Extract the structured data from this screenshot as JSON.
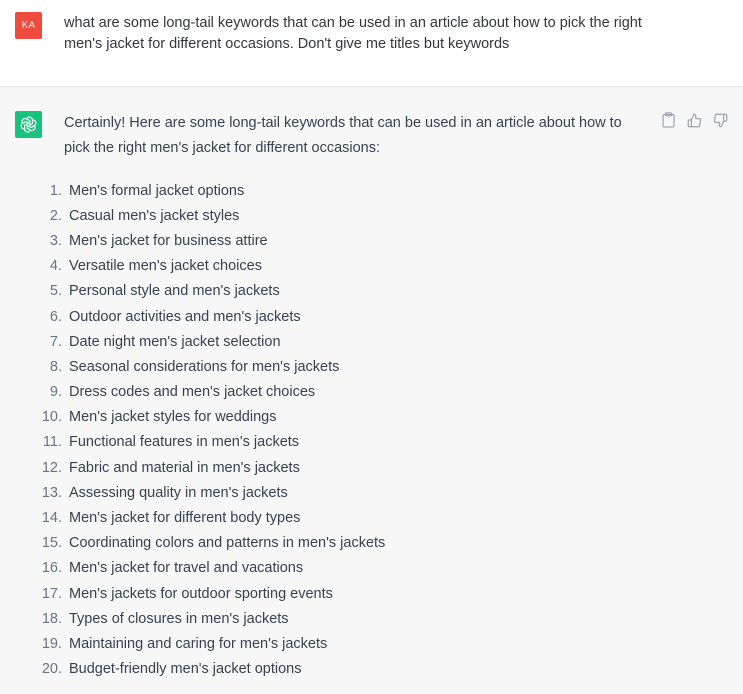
{
  "user_message": {
    "avatar_initials": "KA",
    "avatar_color": "#ef4b3f",
    "text": "what are some long-tail keywords that can be used in an article about how to pick the right men's jacket for different occasions. Don't give me titles but keywords"
  },
  "assistant_message": {
    "avatar_icon": "openai-logo-icon",
    "avatar_color": "#19c37d",
    "intro": "Certainly! Here are some long-tail keywords that can be used in an article about how to pick the right men's jacket for different occasions:",
    "actions": [
      {
        "name": "copy",
        "icon": "clipboard-icon"
      },
      {
        "name": "thumbs-up",
        "icon": "thumbs-up-icon"
      },
      {
        "name": "thumbs-down",
        "icon": "thumbs-down-icon"
      }
    ],
    "keywords": [
      {
        "num": "1.",
        "text": "Men's formal jacket options"
      },
      {
        "num": "2.",
        "text": "Casual men's jacket styles"
      },
      {
        "num": "3.",
        "text": "Men's jacket for business attire"
      },
      {
        "num": "4.",
        "text": "Versatile men's jacket choices"
      },
      {
        "num": "5.",
        "text": "Personal style and men's jackets"
      },
      {
        "num": "6.",
        "text": "Outdoor activities and men's jackets"
      },
      {
        "num": "7.",
        "text": "Date night men's jacket selection"
      },
      {
        "num": "8.",
        "text": "Seasonal considerations for men's jackets"
      },
      {
        "num": "9.",
        "text": "Dress codes and men's jacket choices"
      },
      {
        "num": "10.",
        "text": "Men's jacket styles for weddings"
      },
      {
        "num": "11.",
        "text": "Functional features in men's jackets"
      },
      {
        "num": "12.",
        "text": "Fabric and material in men's jackets"
      },
      {
        "num": "13.",
        "text": "Assessing quality in men's jackets"
      },
      {
        "num": "14.",
        "text": "Men's jacket for different body types"
      },
      {
        "num": "15.",
        "text": "Coordinating colors and patterns in men's jackets"
      },
      {
        "num": "16.",
        "text": "Men's jacket for travel and vacations"
      },
      {
        "num": "17.",
        "text": "Men's jackets for outdoor sporting events"
      },
      {
        "num": "18.",
        "text": "Types of closures in men's jackets"
      },
      {
        "num": "19.",
        "text": "Maintaining and caring for men's jackets"
      },
      {
        "num": "20.",
        "text": "Budget-friendly men's jacket options"
      }
    ]
  }
}
